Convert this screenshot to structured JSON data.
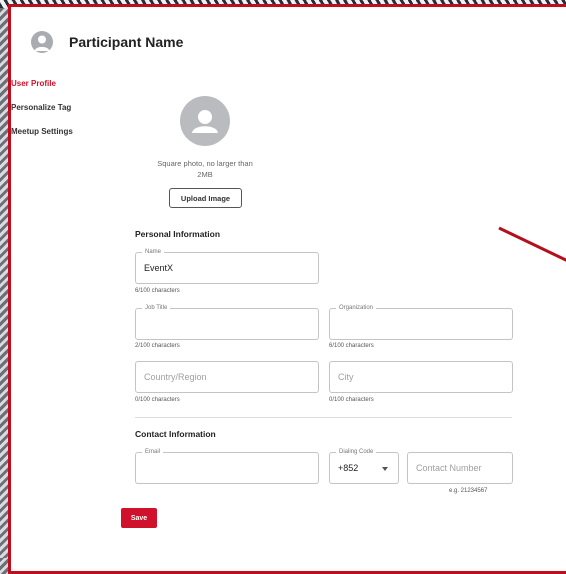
{
  "header": {
    "title": "Participant Name"
  },
  "sidebar": {
    "items": [
      {
        "label": "User Profile"
      },
      {
        "label": "Personalize Tag"
      },
      {
        "label": "Meetup Settings"
      }
    ]
  },
  "photo": {
    "hint": "Square photo, no larger than 2MB",
    "upload_label": "Upload Image"
  },
  "personal": {
    "title": "Personal Information",
    "name": {
      "label": "Name",
      "value": "EventX",
      "count": "6/100 characters"
    },
    "job_title": {
      "label": "Job Title",
      "value": "",
      "count": "2/100 characters"
    },
    "organization": {
      "label": "Organization",
      "value": "",
      "count": "6/100 characters"
    },
    "country": {
      "placeholder": "Country/Region",
      "count": "0/100 characters"
    },
    "city": {
      "placeholder": "City",
      "count": "0/100 characters"
    }
  },
  "contact": {
    "title": "Contact Information",
    "email": {
      "label": "Email",
      "value": ""
    },
    "dialing": {
      "label": "Dialing Code",
      "value": "+852"
    },
    "number": {
      "placeholder": "Contact Number",
      "hint": "e.g. 21234567"
    }
  },
  "actions": {
    "save_label": "Save"
  },
  "colors": {
    "accent": "#d0112b",
    "border": "#c00d1e"
  }
}
